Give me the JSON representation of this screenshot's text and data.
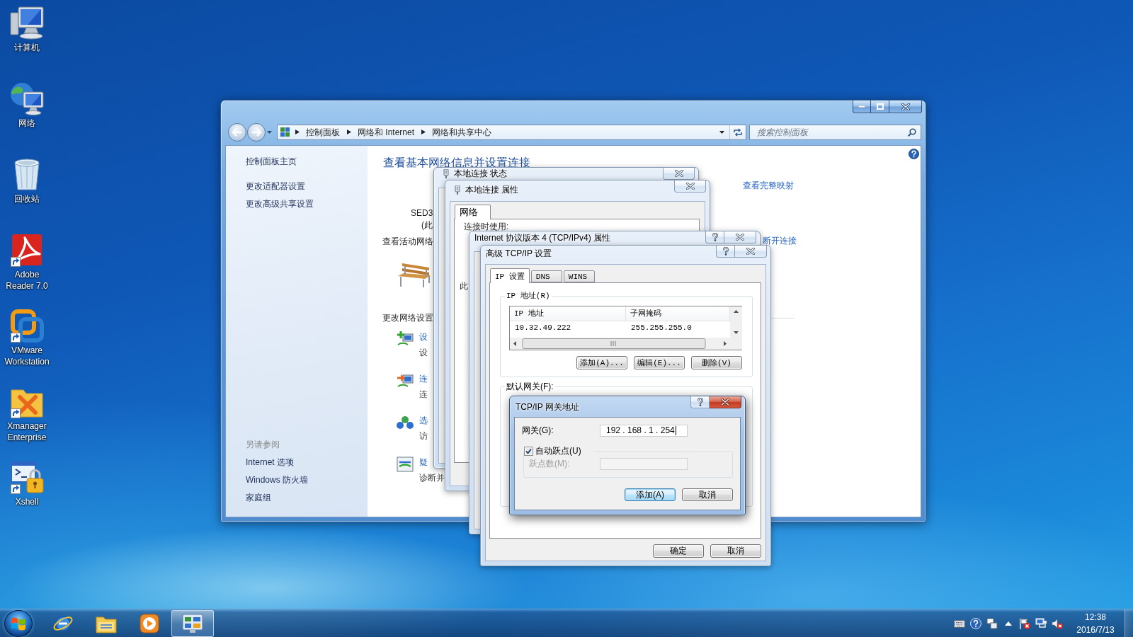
{
  "desktop_icons": [
    {
      "kind": "computer",
      "label": "计算机",
      "shortcut": false
    },
    {
      "kind": "network",
      "label": "网络",
      "shortcut": false
    },
    {
      "kind": "recycle_bin",
      "label": "回收站",
      "shortcut": false
    },
    {
      "kind": "reader",
      "label": "Adobe Reader 7.0",
      "shortcut": true
    },
    {
      "kind": "vmware",
      "label": "VMware Workstation",
      "shortcut": true
    },
    {
      "kind": "xmanager",
      "label": "Xmanager Enterprise",
      "shortcut": true
    },
    {
      "kind": "xshell",
      "label": "Xshell",
      "shortcut": true
    }
  ],
  "control_panel": {
    "active": false,
    "breadcrumb": [
      "控制面板",
      "网络和 Internet",
      "网络和共享中心"
    ],
    "search": {
      "placeholder": "搜索控制面板"
    },
    "sidebar": {
      "items": [
        "控制面板主页",
        "更改适配器设置",
        "更改高级共享设置"
      ],
      "see_also_title": "另请参阅",
      "see_also": [
        "Internet 选项",
        "Windows 防火墙",
        "家庭组"
      ]
    },
    "heading": "查看基本网络信息并设置连接",
    "computer_name": "SED3",
    "computer_note": "(此",
    "active_networks_title": "查看活动网络",
    "change_settings_title": "更改网络设置",
    "tasks": [
      {
        "kind": "new_connection",
        "link": "设",
        "description": "设"
      },
      {
        "kind": "connect",
        "link": "连",
        "description": "连"
      },
      {
        "kind": "homegroup",
        "link": "选",
        "description": "访"
      },
      {
        "kind": "troubleshoot",
        "link": "疑",
        "description": "诊断并"
      }
    ],
    "map_link": "查看完整映射",
    "disconnect_link": "断开连接"
  },
  "status_dialog": {
    "active": false,
    "icon": true,
    "title": "本地连接 状态"
  },
  "properties_dialog": {
    "active": false,
    "icon": true,
    "title": "本地连接 属性",
    "tabs": [
      {
        "label": "网络",
        "selected": true
      }
    ],
    "connect_using_label": "连接时使用:",
    "items_label": "此"
  },
  "ipv4_dialog": {
    "active": false,
    "help_button": true,
    "title": "Internet 协议版本 4 (TCP/IPv4) 属性"
  },
  "advanced_dialog": {
    "active": false,
    "help_button": true,
    "title": "高级 TCP/IP 设置",
    "tabs": [
      {
        "label": "IP 设置",
        "selected": true
      },
      {
        "label": "DNS",
        "selected": false
      },
      {
        "label": "WINS",
        "selected": false
      }
    ],
    "ip_group": {
      "title": "IP 地址(R)",
      "columns": [
        "IP 地址",
        "子网掩码"
      ],
      "rows": [
        [
          "10.32.49.222",
          "255.255.255.0"
        ]
      ],
      "buttons": [
        "添加(A)...",
        "编辑(E)...",
        "删除(V)"
      ]
    },
    "gateway_group": {
      "title": "默认网关(F):"
    },
    "buttons": [
      "确定",
      "取消"
    ]
  },
  "gateway_dialog": {
    "active": true,
    "help_button": true,
    "title": "TCP/IP 网关地址",
    "gateway_label": "网关(G):",
    "gateway_value": "192 . 168 . 1 . 254",
    "auto_metric": {
      "label": "自动跃点(U)",
      "checked": true
    },
    "metric": {
      "label": "跃点数(M):",
      "disabled": true
    },
    "buttons": [
      {
        "label": "添加(A)",
        "default": true
      },
      {
        "label": "取消",
        "default": false
      }
    ]
  },
  "taskbar": {
    "items": [
      {
        "kind": "browser",
        "selected": false
      },
      {
        "kind": "explorer",
        "selected": false
      },
      {
        "kind": "media_player",
        "selected": false
      },
      {
        "kind": "control_panel",
        "selected": true
      }
    ],
    "tray": [
      {
        "kind": "keyboard"
      },
      {
        "kind": "help"
      },
      {
        "kind": "windows"
      },
      {
        "kind": "show_hidden"
      },
      {
        "kind": "action_center"
      },
      {
        "kind": "network"
      },
      {
        "kind": "volume"
      }
    ],
    "clock": {
      "time": "12:38",
      "date": "2016/7/13"
    }
  }
}
